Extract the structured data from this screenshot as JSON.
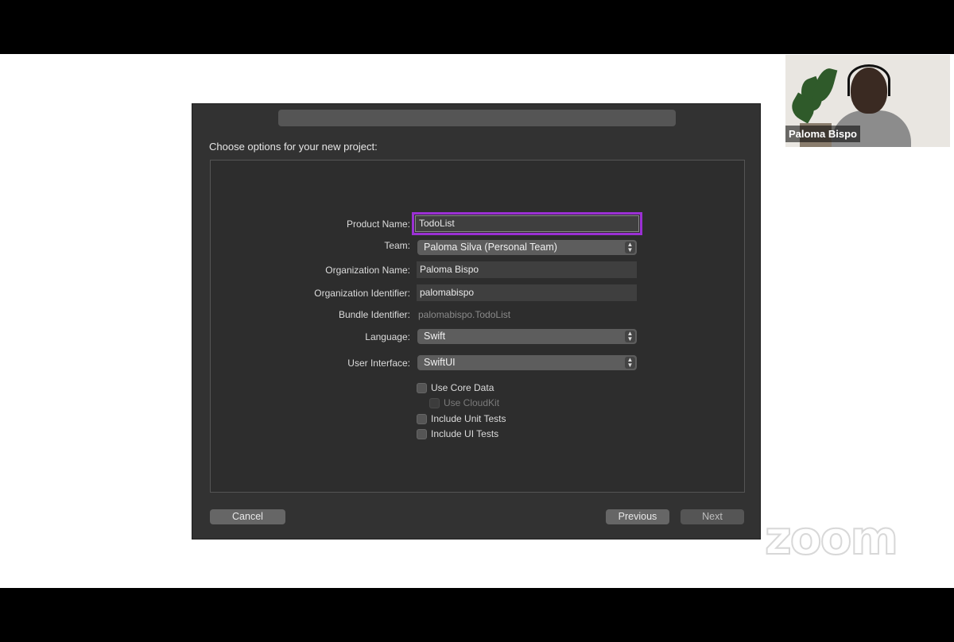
{
  "dialog": {
    "title": "Choose options for your new project:",
    "fields": {
      "product_name": {
        "label": "Product Name:",
        "value": "TodoList"
      },
      "team": {
        "label": "Team:",
        "value": "Paloma Silva (Personal Team)"
      },
      "organization_name": {
        "label": "Organization Name:",
        "value": "Paloma Bispo"
      },
      "organization_identifier": {
        "label": "Organization Identifier:",
        "value": "palomabispo"
      },
      "bundle_identifier": {
        "label": "Bundle Identifier:",
        "value": "palomabispo.TodoList"
      },
      "language": {
        "label": "Language:",
        "value": "Swift"
      },
      "user_interface": {
        "label": "User Interface:",
        "value": "SwiftUI"
      }
    },
    "checkboxes": {
      "use_core_data": "Use Core Data",
      "use_cloudkit": "Use CloudKit",
      "include_unit_tests": "Include Unit Tests",
      "include_ui_tests": "Include UI Tests"
    },
    "buttons": {
      "cancel": "Cancel",
      "previous": "Previous",
      "next": "Next"
    }
  },
  "video": {
    "participant_name": "Paloma Bispo"
  },
  "watermark": "zoom",
  "colors": {
    "focus_ring": "#9b30d4",
    "dialog_bg": "#323232"
  },
  "icons": {
    "popup_stepper": "chevron-up-down-icon"
  }
}
